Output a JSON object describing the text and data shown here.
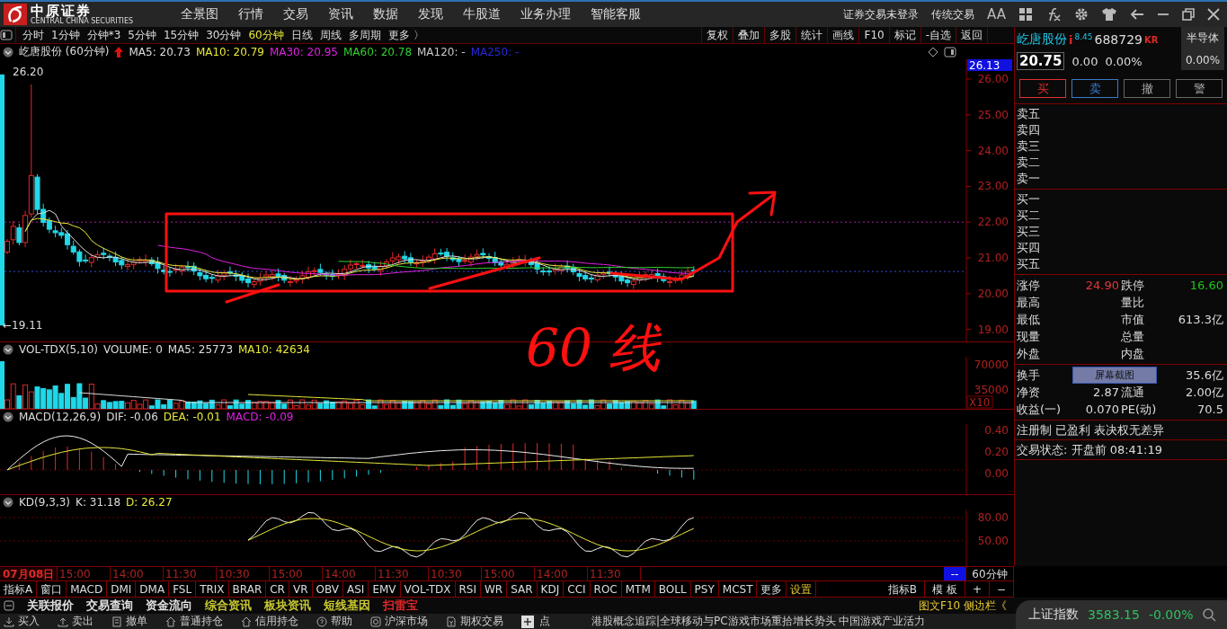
{
  "app": {
    "logo_text": "中原证券",
    "logo_subtext": "CENTRAL CHINA SECURITIES"
  },
  "menu": [
    "全景图",
    "行情",
    "交易",
    "资讯",
    "数据",
    "发现",
    "牛股道",
    "业务办理",
    "智能客服"
  ],
  "top_right": {
    "login_status": "证券交易未登录",
    "classic_trade": "传统交易",
    "font_toggle": "AA"
  },
  "periods": [
    {
      "label": "分时",
      "selected": false
    },
    {
      "label": "1分钟",
      "selected": false
    },
    {
      "label": "分钟*3",
      "selected": false
    },
    {
      "label": "5分钟",
      "selected": false
    },
    {
      "label": "15分钟",
      "selected": false
    },
    {
      "label": "30分钟",
      "selected": false
    },
    {
      "label": "60分钟",
      "selected": true
    },
    {
      "label": "日线",
      "selected": false
    },
    {
      "label": "周线",
      "selected": false
    },
    {
      "label": "多周期",
      "selected": false
    },
    {
      "label": "更多 〉",
      "selected": false
    }
  ],
  "tools": [
    "复权",
    "叠加",
    "多股",
    "统计",
    "画线",
    "F10",
    "标记",
    "-自选",
    "返回"
  ],
  "main_chart": {
    "title": "屹唐股份 (60分钟)",
    "ma": [
      {
        "label": "MA5: 20.73",
        "color": "#dddddd"
      },
      {
        "label": "MA10: 20.79",
        "color": "#e8e83a"
      },
      {
        "label": "MA30: 20.95",
        "color": "#e020e0"
      },
      {
        "label": "MA60: 20.78",
        "color": "#30d030"
      },
      {
        "label": "MA120: -",
        "color": "#c8c8c8"
      },
      {
        "label": "MA250: -",
        "color": "#2828d8"
      }
    ],
    "current_tag": "26.13",
    "high_label": "26.20",
    "low_label": "←19.11",
    "axis": [
      "26.00",
      "25.00",
      "24.00",
      "23.00",
      "22.00",
      "21.00",
      "20.00",
      "19.00"
    ]
  },
  "annotation": {
    "text": "60 线"
  },
  "volume_panel": {
    "title": "VOL-TDX(5,10)",
    "legend": [
      {
        "label": "VOLUME: 0",
        "color": "#dddddd"
      },
      {
        "label": "MA5: 25773",
        "color": "#dddddd"
      },
      {
        "label": "MA10: 42634",
        "color": "#e8e83a"
      }
    ],
    "axis": [
      "70000",
      "35000"
    ],
    "scale": "X10"
  },
  "macd_panel": {
    "title": "MACD(12,26,9)",
    "legend": [
      {
        "label": "DIF: -0.06",
        "color": "#dddddd"
      },
      {
        "label": "DEA: -0.01",
        "color": "#e8e83a"
      },
      {
        "label": "MACD: -0.09",
        "color": "#e020e0"
      }
    ],
    "axis": [
      "0.40",
      "0.20",
      "0.00"
    ]
  },
  "kd_panel": {
    "title": "KD(9,3,3)",
    "legend": [
      {
        "label": "K: 31.18",
        "color": "#dddddd"
      },
      {
        "label": "D: 26.27",
        "color": "#e8e83a"
      }
    ],
    "axis": [
      "80.00",
      "50.00"
    ]
  },
  "quote": {
    "name": "屹唐股份",
    "info_mark": "i",
    "superscript": "8.45",
    "code": "688729",
    "tag": "KR",
    "sector": "半导体",
    "price": "20.75",
    "change": "0.00",
    "percent": "0.00%",
    "sector_change": "0.00%"
  },
  "trade_buttons": [
    {
      "label": "买",
      "kind": "buy"
    },
    {
      "label": "卖",
      "kind": "sell"
    },
    {
      "label": "撤",
      "kind": "cancel"
    },
    {
      "label": "警",
      "kind": "alert"
    }
  ],
  "asks": [
    "卖五",
    "卖四",
    "卖三",
    "卖二",
    "卖一"
  ],
  "bids": [
    "买一",
    "买二",
    "买三",
    "买四",
    "买五"
  ],
  "stats": [
    [
      {
        "label": "涨停",
        "value": "24.90",
        "color": "#e03838"
      },
      {
        "label": "跌停",
        "value": "16.60",
        "color": "#20c020"
      }
    ],
    [
      {
        "label": "最高"
      },
      {
        "label": "量比"
      }
    ],
    [
      {
        "label": "最低"
      },
      {
        "label": "市值",
        "value": "613.3亿",
        "color": "#dddddd"
      }
    ],
    [
      {
        "label": "现量"
      },
      {
        "label": "总量"
      }
    ],
    [
      {
        "label": "外盘"
      },
      {
        "label": "内盘"
      }
    ]
  ],
  "stats2": [
    [
      {
        "label": "换手"
      },
      {
        "value": "35.6亿",
        "color": "#dddddd"
      }
    ],
    [
      {
        "label": "净资",
        "value": "2.87",
        "color": "#dddddd"
      },
      {
        "label": "流通",
        "value": "2.00亿",
        "color": "#dddddd"
      }
    ],
    [
      {
        "label": "收益(一)",
        "value": "0.070",
        "color": "#dddddd"
      },
      {
        "label": "PE(动)",
        "value": "70.5",
        "color": "#dddddd"
      }
    ]
  ],
  "screenshot_tooltip": "屏幕截图",
  "tags_line": "注册制 已盈利 表决权无差异",
  "trade_status": "交易状态: 开盘前 08:41:19",
  "time_axis": {
    "date": "07月08日",
    "ticks": [
      "15:00",
      "14:00",
      "11:30",
      "10:30",
      "15:00",
      "14:00",
      "11:30",
      "10:30",
      "15:00",
      "14:00",
      "11:30"
    ],
    "marker": "--",
    "period": "60分钟"
  },
  "indicators": [
    {
      "label": "指标A",
      "kind": "plain"
    },
    {
      "label": "窗口",
      "kind": "plain"
    },
    {
      "label": "MACD",
      "kind": "plain"
    },
    {
      "label": "DMI",
      "kind": "plain"
    },
    {
      "label": "DMA",
      "kind": "plain"
    },
    {
      "label": "FSL",
      "kind": "plain"
    },
    {
      "label": "TRIX",
      "kind": "plain"
    },
    {
      "label": "BRAR",
      "kind": "plain"
    },
    {
      "label": "CR",
      "kind": "plain"
    },
    {
      "label": "VR",
      "kind": "plain"
    },
    {
      "label": "OBV",
      "kind": "plain"
    },
    {
      "label": "ASI",
      "kind": "plain"
    },
    {
      "label": "EMV",
      "kind": "plain"
    },
    {
      "label": "VOL-TDX",
      "kind": "plain"
    },
    {
      "label": "RSI",
      "kind": "plain"
    },
    {
      "label": "WR",
      "kind": "plain"
    },
    {
      "label": "SAR",
      "kind": "plain"
    },
    {
      "label": "KDJ",
      "kind": "plain"
    },
    {
      "label": "CCI",
      "kind": "plain"
    },
    {
      "label": "ROC",
      "kind": "plain"
    },
    {
      "label": "MTM",
      "kind": "plain"
    },
    {
      "label": "BOLL",
      "kind": "plain"
    },
    {
      "label": "PSY",
      "kind": "plain"
    },
    {
      "label": "MCST",
      "kind": "plain"
    },
    {
      "label": "更多",
      "kind": "plain"
    },
    {
      "label": "设置",
      "kind": "setting"
    }
  ],
  "indicators_right": [
    "指标B",
    "模 板",
    "+",
    "−"
  ],
  "links": [
    {
      "label": "关联报价",
      "color": "#e0e0e0"
    },
    {
      "label": "交易查询",
      "color": "#e0e0e0"
    },
    {
      "label": "资金流向",
      "color": "#e0e0e0"
    },
    {
      "label": "综合资讯",
      "color": "#c8c832"
    },
    {
      "label": "板块资讯",
      "color": "#c8c832"
    },
    {
      "label": "短线基因",
      "color": "#c8c832"
    },
    {
      "label": "扫雷宝",
      "color": "#e02828"
    }
  ],
  "sidebar_label": "图文F10 侧边栏《",
  "toolbar": [
    "买入",
    "卖出",
    "撤单",
    "普通持仓",
    "信用持仓",
    "帮助",
    "沪深市场",
    "期权交易"
  ],
  "news": {
    "prefix": "点",
    "text": "港股概念追踪|全球移动与PC游戏市场重拾增长势头 中国游戏产业活力"
  },
  "index_widget": {
    "name": "上证指数",
    "value": "3583.15",
    "change": "-0.00%"
  }
}
